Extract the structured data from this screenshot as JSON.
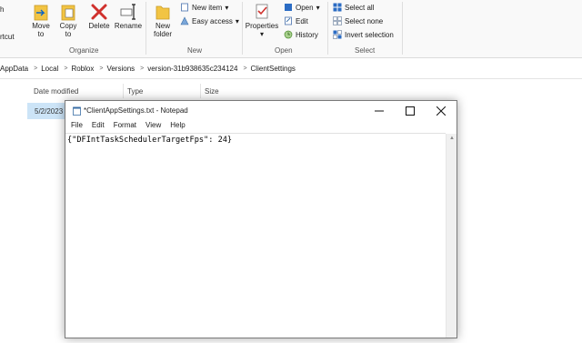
{
  "ribbon": {
    "partial_left_top": "h",
    "partial_left_bottom": "rtcut",
    "organize": {
      "label": "Organize",
      "move_to": [
        "Move",
        "to"
      ],
      "copy_to": [
        "Copy",
        "to"
      ],
      "delete": "Delete",
      "rename": "Rename"
    },
    "new": {
      "label": "New",
      "new_folder": [
        "New",
        "folder"
      ],
      "new_item": "New item",
      "easy_access": "Easy access"
    },
    "open": {
      "label": "Open",
      "properties": "Properties",
      "open": "Open",
      "edit": "Edit",
      "history": "History"
    },
    "select": {
      "label": "Select",
      "select_all": "Select all",
      "select_none": "Select none",
      "invert_selection": "Invert selection"
    }
  },
  "address": {
    "crumbs": [
      "AppData",
      "Local",
      "Roblox",
      "Versions",
      "version-31b938635c234124",
      "ClientSettings"
    ]
  },
  "file_list": {
    "columns": [
      "Date modified",
      "Type",
      "Size"
    ],
    "rows": [
      {
        "date": "5/2/2023"
      }
    ]
  },
  "notepad": {
    "title": "*ClientAppSettings.txt - Notepad",
    "menu": [
      "File",
      "Edit",
      "Format",
      "View",
      "Help"
    ],
    "content": "{\"DFIntTaskSchedulerTargetFps\": 24}"
  },
  "colors": {
    "accent": "#0a64c8",
    "selection": "#cce4f7",
    "delete_red": "#d0312d",
    "folder_yellow": "#f2c443"
  }
}
